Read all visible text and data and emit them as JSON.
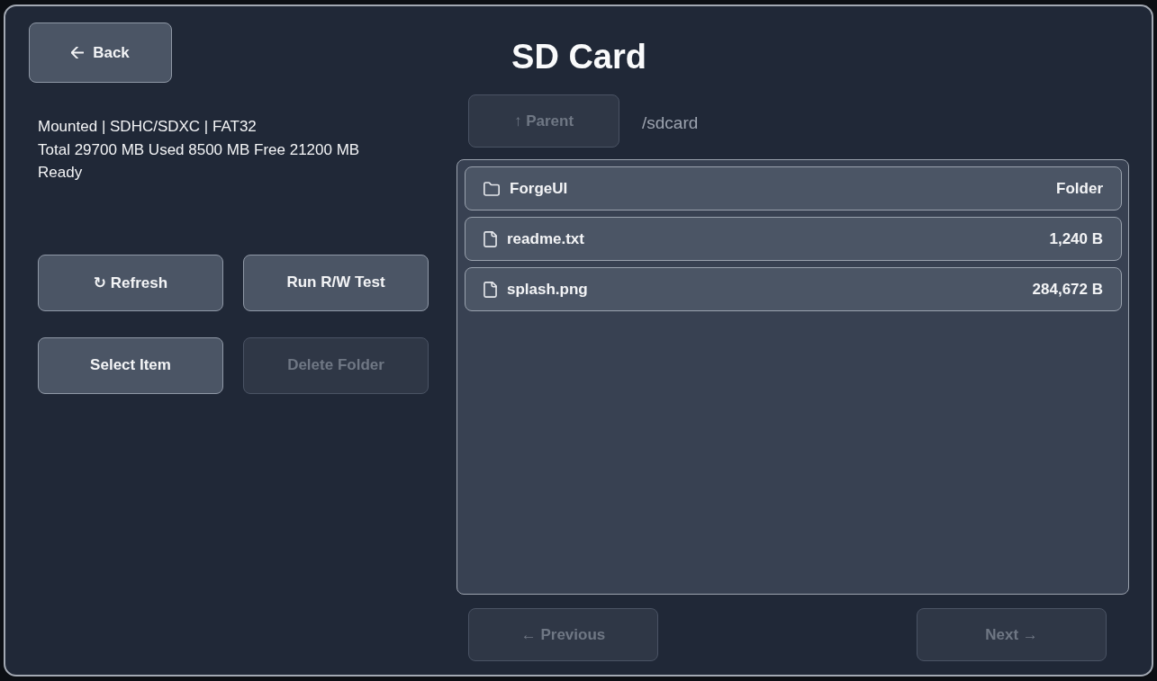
{
  "header": {
    "back_button": {
      "label": "Back",
      "disabled": false
    },
    "title": "SD Card"
  },
  "status": {
    "lines": [
      "Mounted | SDHC/SDXC | FAT32",
      "Total 29700 MB Used 8500 MB Free 21200 MB",
      "Ready"
    ]
  },
  "actions": [
    {
      "label": "↻ Refresh",
      "disabled": false
    },
    {
      "label": "Run R/W Test",
      "disabled": false
    },
    {
      "label": "Select Item",
      "disabled": false
    },
    {
      "label": "Delete Folder",
      "disabled": true
    }
  ],
  "browser": {
    "parent_button": {
      "label": "↑ Parent",
      "disabled": true
    },
    "path": "/sdcard",
    "entries": [
      {
        "kind": "folder",
        "name": "ForgeUI",
        "detail": "Folder"
      },
      {
        "kind": "file",
        "name": "readme.txt",
        "detail": "1,240 B"
      },
      {
        "kind": "file",
        "name": "splash.png",
        "detail": "284,672 B"
      }
    ],
    "pagination": [
      {
        "label": "← Previous",
        "disabled": true
      },
      {
        "label": "Next →",
        "disabled": true
      }
    ]
  }
}
